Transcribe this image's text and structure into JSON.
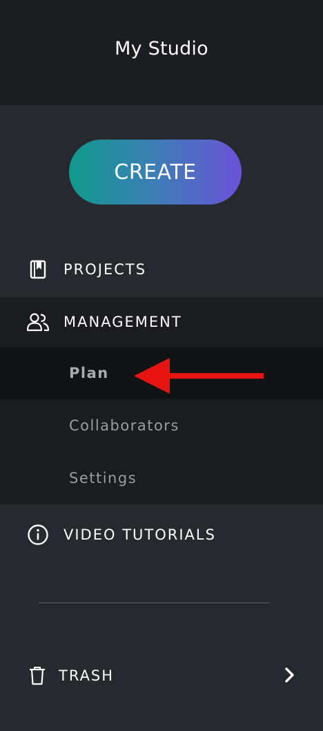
{
  "header": {
    "title": "My Studio"
  },
  "create_button": {
    "label": "CREATE"
  },
  "nav": {
    "projects": {
      "label": "PROJECTS",
      "icon": "bookmark-book-icon"
    },
    "management": {
      "label": "MANAGEMENT",
      "icon": "users-icon",
      "items": [
        {
          "label": "Plan",
          "active": true
        },
        {
          "label": "Collaborators",
          "active": false
        },
        {
          "label": "Settings",
          "active": false
        }
      ]
    },
    "tutorials": {
      "label": "VIDEO TUTORIALS",
      "icon": "info-icon"
    },
    "trash": {
      "label": "TRASH",
      "icon": "trash-icon"
    }
  },
  "annotation": {
    "arrow_color": "#e81313"
  },
  "colors": {
    "header_bg": "#1a1c1f",
    "sidebar_bg": "#26292d",
    "gradient_start": "#0e9a8c",
    "gradient_end": "#6a53d8"
  }
}
